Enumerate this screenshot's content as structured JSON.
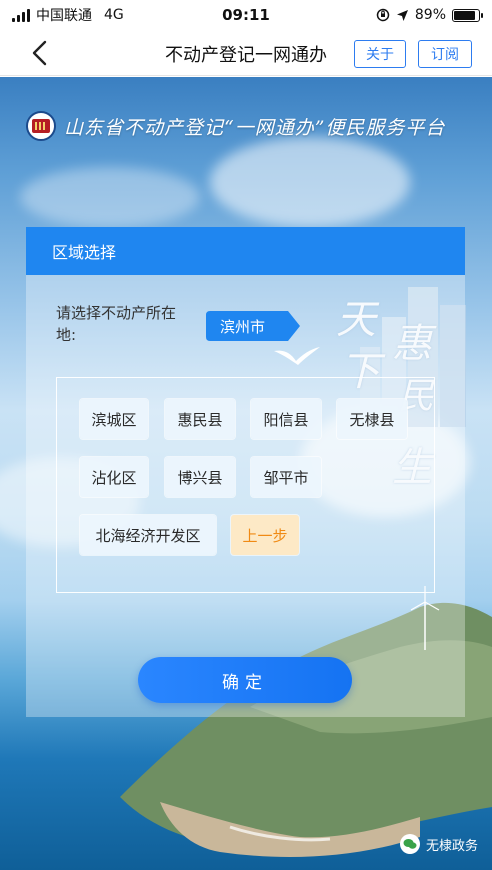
{
  "status_bar": {
    "carrier": "中国联通",
    "network": "4G",
    "time": "09:11",
    "battery": "89%",
    "battery_level": 0.89
  },
  "nav": {
    "title": "不动产登记一网通办",
    "about_label": "关于",
    "subscribe_label": "订阅"
  },
  "banner": {
    "platform_name": "山东省不动产登记“一网通办”便民服务平台"
  },
  "region_panel": {
    "header": "区域选择",
    "prompt": "请选择不动产所在地:",
    "selected_city": "滨州市",
    "districts": [
      "滨城区",
      "惠民县",
      "阳信县",
      "无棣县",
      "沾化区",
      "博兴县",
      "邹平市",
      "北海经济开发区"
    ],
    "previous_label": "上一步",
    "confirm_label": "确定"
  },
  "background_calligraphy": [
    "天",
    "下",
    "惠",
    "民",
    "生"
  ],
  "watermark": {
    "text": "无棣政务"
  },
  "colors": {
    "accent": "#1f86f0",
    "nav_button": "#2d7cf0",
    "previous_text": "#f08a14",
    "previous_bg": "#fde9c6"
  }
}
